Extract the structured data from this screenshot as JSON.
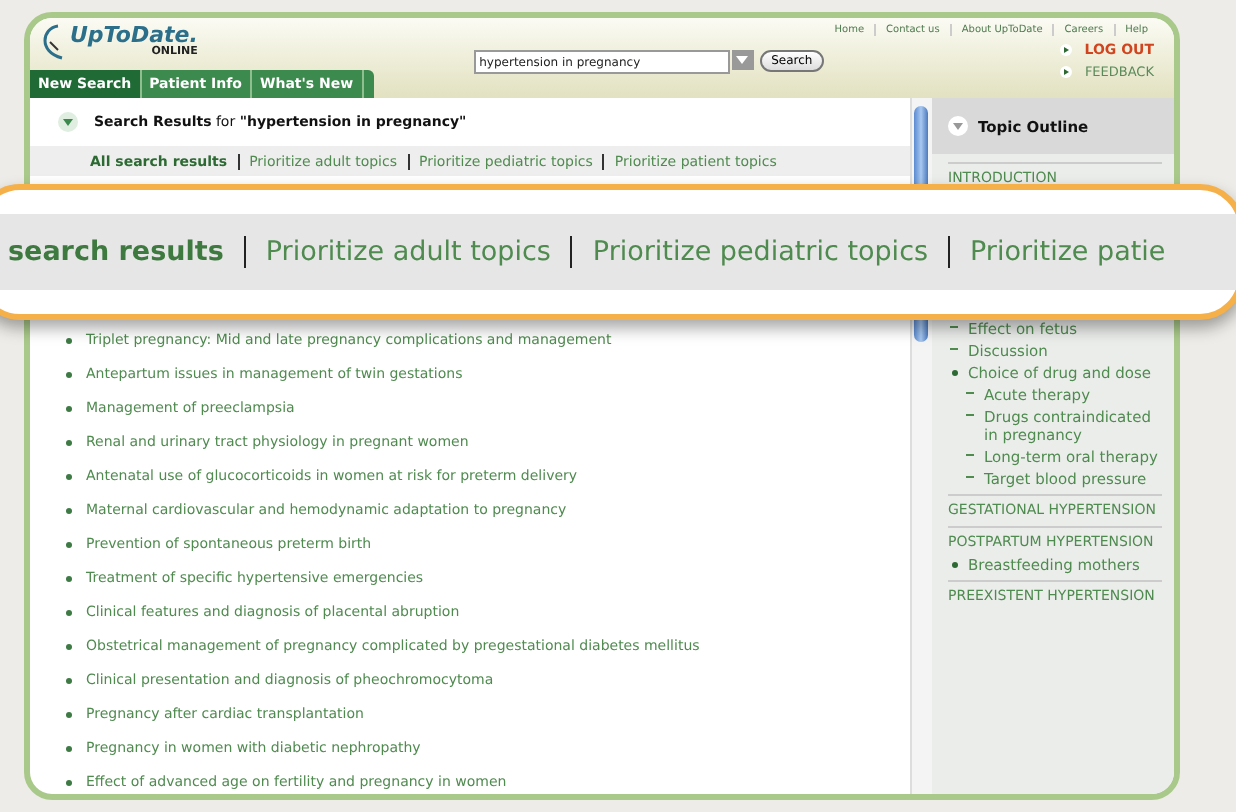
{
  "header": {
    "logo": {
      "name": "UpToDate.",
      "subtitle": "ONLINE"
    },
    "top_links": [
      "Home",
      "Contact us",
      "About UpToDate",
      "Careers",
      "Help"
    ],
    "search": {
      "value": "hypertension in pregnancy",
      "button": "Search"
    },
    "actions": [
      {
        "label": "LOG OUT",
        "kind": "primary"
      },
      {
        "label": "FEEDBACK",
        "kind": "secondary"
      }
    ],
    "tabs": [
      {
        "label": "New Search",
        "selected": true
      },
      {
        "label": "Patient Info",
        "selected": false
      },
      {
        "label": "What's New",
        "selected": false
      }
    ]
  },
  "results": {
    "heading": "**Search Results** for **\"hypertension in pregnancy\"**",
    "filters": [
      {
        "label": "All search results",
        "selected": true
      },
      {
        "label": "Prioritize adult topics",
        "selected": false
      },
      {
        "label": "Prioritize pediatric topics",
        "selected": false
      },
      {
        "label": "Prioritize patient topics",
        "selected": false
      }
    ],
    "items": [
      "Triplet pregnancy: Mid and late pregnancy complications and management",
      "Antepartum issues in management of twin gestations",
      "Management of preeclampsia",
      "Renal and urinary tract physiology in pregnant women",
      "Antenatal use of glucocorticoids in women at risk for preterm delivery",
      "Maternal cardiovascular and hemodynamic adaptation to pregnancy",
      "Prevention of spontaneous preterm birth",
      "Treatment of specific hypertensive emergencies",
      "Clinical features and diagnosis of placental abruption",
      "Obstetrical management of pregnancy complicated by pregestational diabetes mellitus",
      "Clinical presentation and diagnosis of pheochromocytoma",
      "Pregnancy after cardiac transplantation",
      "Pregnancy in women with diabetic nephropathy",
      "Effect of advanced age on fertility and pregnancy in women"
    ]
  },
  "outline": {
    "title": "Topic Outline",
    "sections": [
      {
        "label": "INTRODUCTION",
        "children": [
          {
            "label": "Effect on fetus",
            "kind": "dash"
          },
          {
            "label": "Discussion",
            "kind": "dash"
          },
          {
            "label": "Choice of drug and dose",
            "kind": "bullet",
            "children": [
              {
                "label": "Acute therapy",
                "kind": "dash"
              },
              {
                "label": "Drugs contraindicated in pregnancy",
                "kind": "dash"
              },
              {
                "label": "Long-term oral therapy",
                "kind": "dash"
              },
              {
                "label": "Target blood pressure",
                "kind": "dash"
              }
            ]
          }
        ]
      },
      {
        "label": "GESTATIONAL HYPERTENSION"
      },
      {
        "label": "POSTPARTUM HYPERTENSION",
        "children": [
          {
            "label": "Breastfeeding mothers",
            "kind": "bullet"
          }
        ]
      },
      {
        "label": "PREEXISTENT HYPERTENSION"
      }
    ]
  },
  "magnifier": {
    "filters": [
      {
        "label": "search results",
        "selected": true
      },
      {
        "label": "Prioritize adult topics",
        "selected": false
      },
      {
        "label": "Prioritize pediatric topics",
        "selected": false
      },
      {
        "label": "Prioritize patie",
        "selected": false
      }
    ]
  }
}
